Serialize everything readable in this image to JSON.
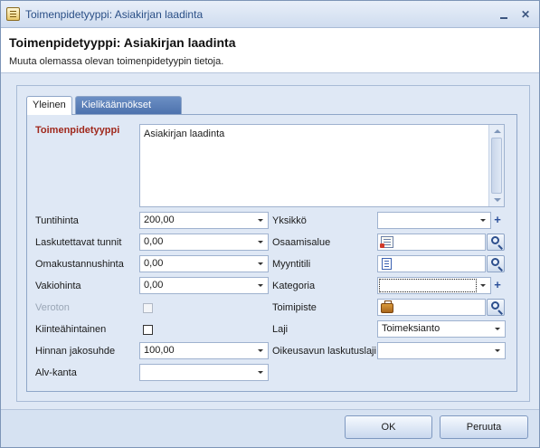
{
  "window": {
    "title": "Toimenpidetyyppi: Asiakirjan laadinta"
  },
  "header": {
    "title": "Toimenpidetyyppi: Asiakirjan laadinta",
    "subtitle": "Muuta olemassa olevan toimenpidetyypin tietoja."
  },
  "tabs": {
    "general": "Yleinen",
    "translations": "Kielikäännökset"
  },
  "form": {
    "toimenpidetyyppi": {
      "label": "Toimenpidetyyppi",
      "value": "Asiakirjan laadinta"
    },
    "tuntihinta": {
      "label": "Tuntihinta",
      "value": "200,00"
    },
    "laskutettavat": {
      "label": "Laskutettavat tunnit",
      "value": "0,00"
    },
    "omakustannus": {
      "label": "Omakustannushinta",
      "value": "0,00"
    },
    "vakiohinta": {
      "label": "Vakiohinta",
      "value": "0,00"
    },
    "veroton": {
      "label": "Veroton"
    },
    "kiintea": {
      "label": "Kiinteähintainen"
    },
    "jakosuhde": {
      "label": "Hinnan jakosuhde",
      "value": "100,00"
    },
    "alv": {
      "label": "Alv-kanta",
      "value": ""
    },
    "yksikko": {
      "label": "Yksikkö",
      "value": ""
    },
    "osaamisalue": {
      "label": "Osaamisalue",
      "value": ""
    },
    "myyntitili": {
      "label": "Myyntitili",
      "value": ""
    },
    "kategoria": {
      "label": "Kategoria",
      "value": ""
    },
    "toimipiste": {
      "label": "Toimipiste",
      "value": ""
    },
    "laji": {
      "label": "Laji",
      "value": "Toimeksianto"
    },
    "oikeusavun": {
      "label": "Oikeusavun laskutuslaji",
      "value": ""
    }
  },
  "buttons": {
    "ok": "OK",
    "cancel": "Peruuta"
  }
}
